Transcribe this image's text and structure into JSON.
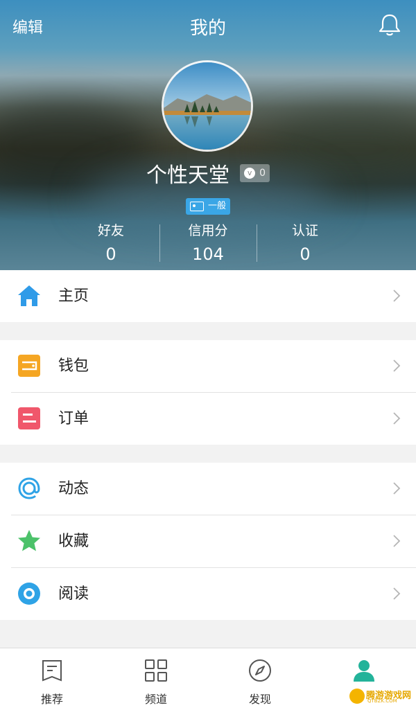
{
  "header": {
    "edit_label": "编辑",
    "title": "我的",
    "bell_icon": "bell-icon",
    "username": "个性天堂",
    "verify_count": "0",
    "level_label": "一般"
  },
  "stats": [
    {
      "label": "好友",
      "value": "0"
    },
    {
      "label": "信用分",
      "value": "104"
    },
    {
      "label": "认证",
      "value": "0"
    }
  ],
  "menu": {
    "home": {
      "label": "主页",
      "icon": "home-icon",
      "color": "#2f9be8"
    },
    "wallet": {
      "label": "钱包",
      "icon": "wallet-icon",
      "color": "#f5a623"
    },
    "orders": {
      "label": "订单",
      "icon": "order-icon",
      "color": "#f0576b"
    },
    "feed": {
      "label": "动态",
      "icon": "at-icon",
      "color": "#2fa3e6"
    },
    "favorites": {
      "label": "收藏",
      "icon": "star-icon",
      "color": "#4cc26a"
    },
    "reading": {
      "label": "阅读",
      "icon": "eye-icon",
      "color": "#2fa3e6"
    }
  },
  "tabs": [
    {
      "label": "推荐",
      "icon": "bookmark-icon",
      "active": false
    },
    {
      "label": "频道",
      "icon": "grid-icon",
      "active": false
    },
    {
      "label": "发现",
      "icon": "compass-icon",
      "active": false
    },
    {
      "label": "",
      "icon": "profile-icon",
      "active": true
    }
  ],
  "watermark": {
    "text": "腾游游戏网",
    "sub": "QTBZK.COM"
  },
  "colors": {
    "accent": "#23b39a",
    "brand_blue": "#3aa6e6"
  }
}
